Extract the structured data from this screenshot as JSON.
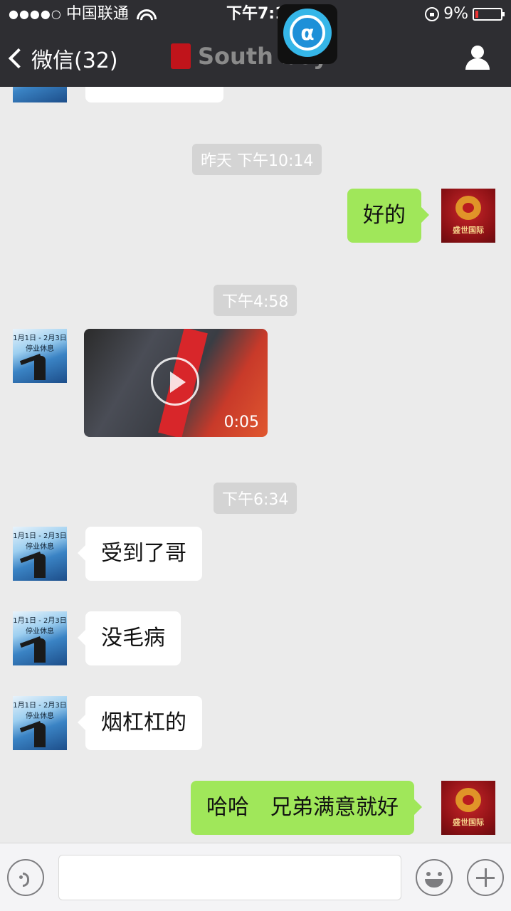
{
  "status_bar": {
    "signal_dots": "●●●●○",
    "carrier": "中国联通",
    "time": "下午7:11",
    "battery_percent": "9%"
  },
  "overlay": {
    "app_icon_glyph": "α"
  },
  "nav": {
    "back_label": "微信(32)",
    "title": "South boy"
  },
  "messages": {
    "ts1": "昨天 下午10:14",
    "m1": "好的",
    "ts2": "下午4:58",
    "video_duration": "0:05",
    "ts3": "下午6:34",
    "m2": "受到了哥",
    "m3": "没毛病",
    "m4": "烟杠杠的",
    "m5": "哈哈　兄弟满意就好"
  },
  "avatars": {
    "contact_caption": "1月1日 - 2月3日 停业休息",
    "self_caption": "盛世国际"
  },
  "colors": {
    "nav_bg": "#2e2e32",
    "chat_bg": "#ebebeb",
    "bubble_sent": "#a0e75a",
    "bubble_received": "#ffffff",
    "timestamp_bg": "#d4d4d4"
  }
}
